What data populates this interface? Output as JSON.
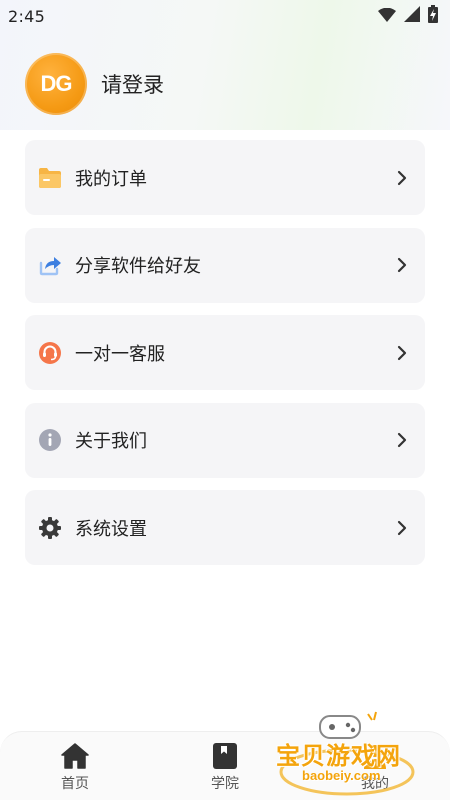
{
  "status_bar": {
    "time": "2:45",
    "icons": [
      "wifi-icon",
      "signal-icon",
      "battery-charging-icon"
    ]
  },
  "profile": {
    "avatar_logo": "DG",
    "login_text": "请登录",
    "avatar_color": "#f59a14"
  },
  "menu": {
    "items": [
      {
        "label": "我的订单",
        "icon": "folder-icon",
        "icon_color": "#f7b545"
      },
      {
        "label": "分享软件给好友",
        "icon": "share-icon",
        "icon_color": "#3d7fe0"
      },
      {
        "label": "一对一客服",
        "icon": "headset-icon",
        "icon_color": "#f5764a"
      },
      {
        "label": "关于我们",
        "icon": "info-icon",
        "icon_color": "#a3a6b4"
      },
      {
        "label": "系统设置",
        "icon": "gear-icon",
        "icon_color": "#3a3a3a"
      }
    ]
  },
  "tab_bar": {
    "tabs": [
      {
        "label": "首页",
        "icon": "home-icon"
      },
      {
        "label": "学院",
        "icon": "book-icon"
      },
      {
        "label": "我的",
        "icon": "user-icon"
      }
    ]
  },
  "watermark": {
    "title": "宝贝游戏网",
    "url": "baobeiy.com"
  }
}
